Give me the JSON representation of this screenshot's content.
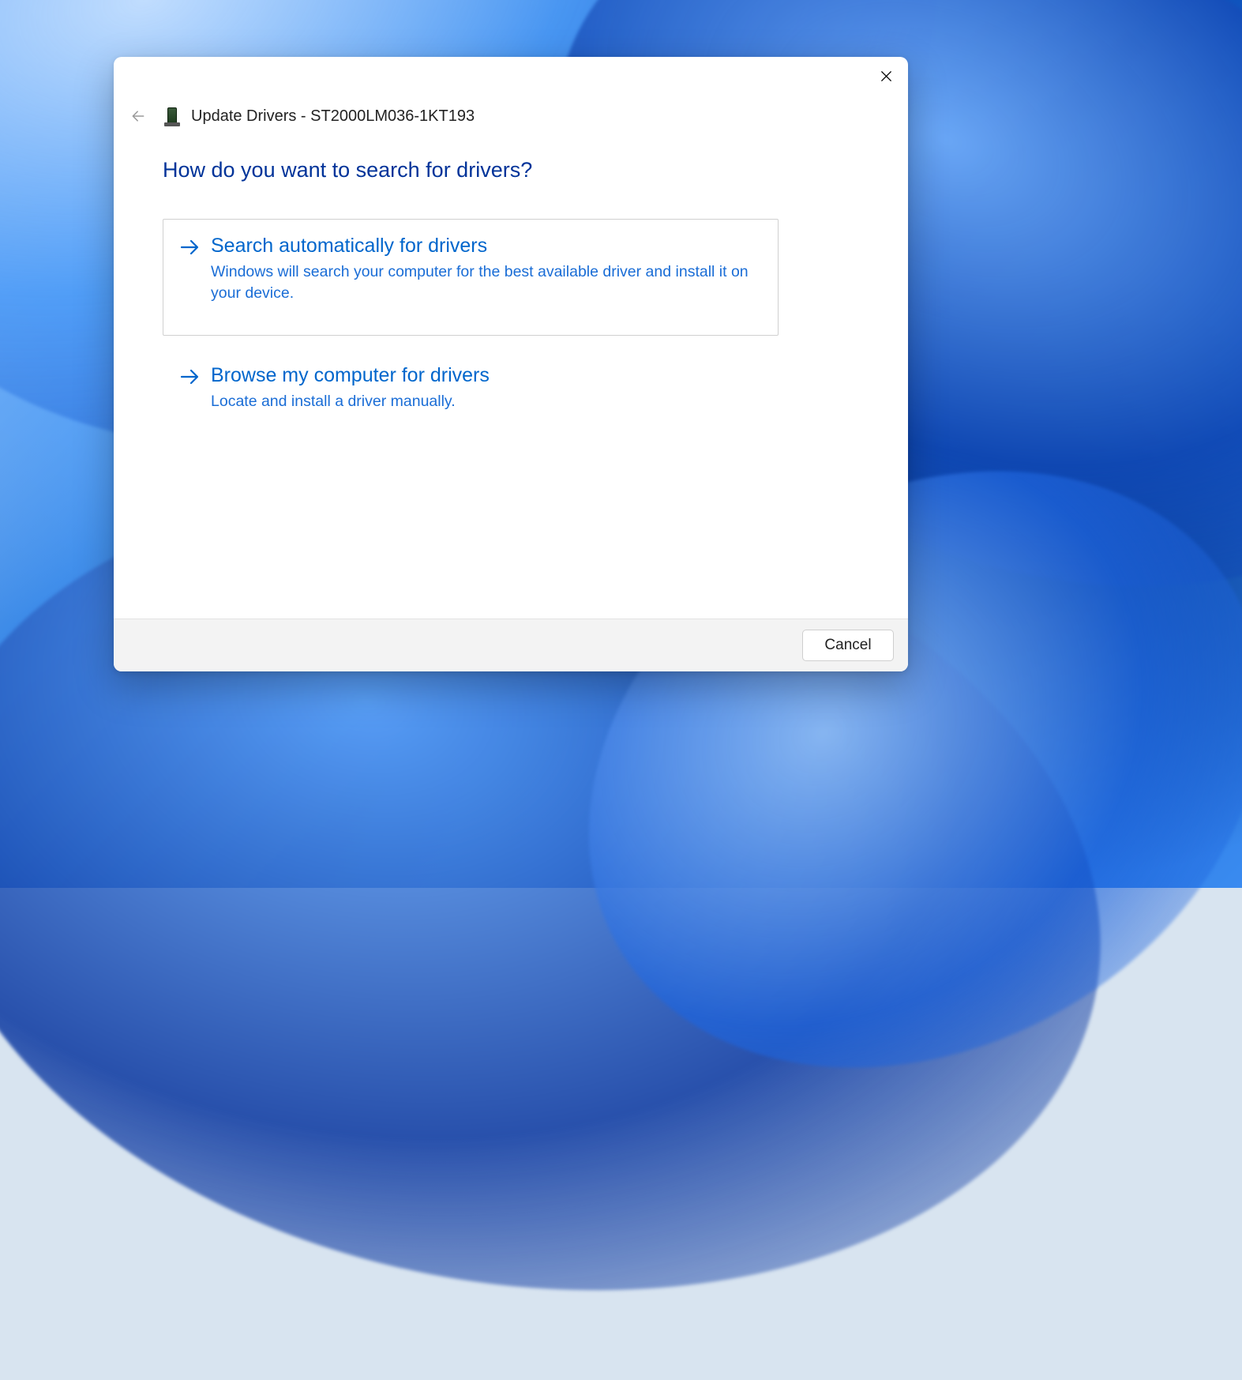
{
  "dialog": {
    "title": "Update Drivers - ST2000LM036-1KT193",
    "heading": "How do you want to search for drivers?",
    "options": [
      {
        "title": "Search automatically for drivers",
        "description": "Windows will search your computer for the best available driver and install it on your device.",
        "selected": true
      },
      {
        "title": "Browse my computer for drivers",
        "description": "Locate and install a driver manually.",
        "selected": false
      }
    ],
    "footer": {
      "cancel_label": "Cancel"
    }
  }
}
